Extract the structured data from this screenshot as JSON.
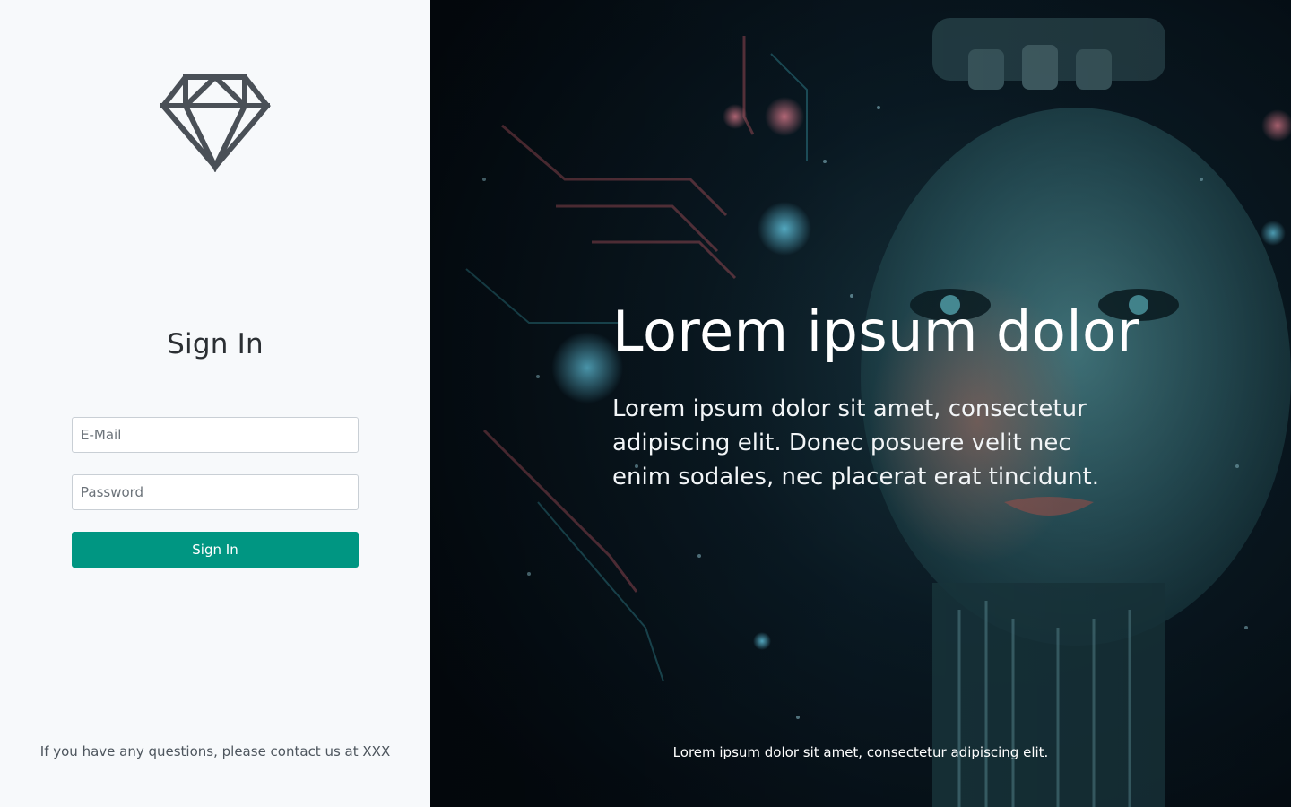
{
  "left": {
    "logo_icon": "diamond-icon",
    "title": "Sign In",
    "email": {
      "placeholder": "E-Mail",
      "value": ""
    },
    "password": {
      "placeholder": "Password",
      "value": ""
    },
    "signin_label": "Sign In",
    "contact_text": "If you have any questions, please contact us at XXX"
  },
  "right": {
    "title": "Lorem ipsum dolor",
    "subtitle": "Lorem ipsum dolor sit amet, consectetur adipiscing elit. Donec posuere velit nec enim sodales, nec placerat erat tincidunt.",
    "footer": "Lorem ipsum dolor sit amet, consectetur adipiscing elit."
  },
  "colors": {
    "accent": "#009682",
    "left_background": "#f7f9fb",
    "logo": "#4a5057"
  }
}
